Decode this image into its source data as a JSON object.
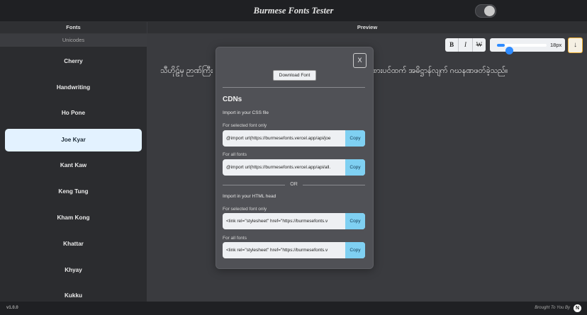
{
  "app": {
    "title": "Burmese Fonts Tester",
    "version": "v1.0.0",
    "credit": "Brought To You By",
    "credit_logo": "N"
  },
  "sidebar": {
    "header": "Fonts",
    "unicodes": "Unicodes",
    "items": [
      {
        "label": "Cherry"
      },
      {
        "label": "Handwriting"
      },
      {
        "label": "Ho Pone"
      },
      {
        "label": "Joe Kyar",
        "selected": true
      },
      {
        "label": "Kant Kaw"
      },
      {
        "label": "Keng Tung"
      },
      {
        "label": "Kham Kong"
      },
      {
        "label": "Khattar"
      },
      {
        "label": "Khyay"
      },
      {
        "label": "Kukku"
      }
    ]
  },
  "preview": {
    "header": "Preview",
    "text_left": "သီဟိုဠ်မှ ဉာဏ်ကြီး",
    "text_right": "စားပင်ထက် အဓိဋ္ဌာန်လျက် ဂဃနဏဖတ်ခဲ့သည်။",
    "bold": "B",
    "italic": "I",
    "strike": "W",
    "font_size": "18px",
    "font_size_fraction": 0.1,
    "download_icon": "↓"
  },
  "modal": {
    "close": "X",
    "download_font": "Download Font",
    "cdn_title": "CDNs",
    "css_section": "Import in your CSS file",
    "html_section": "Import in your HTML head",
    "or": "OR",
    "selected_label": "For selected font only",
    "all_label": "For all fonts",
    "copy": "Copy",
    "css_selected": "@import url(https://burmesefonts.vercel.app/api/joe",
    "css_all": "@import url(https://burmesefonts.vercel.app/api/all.",
    "html_selected": "<link rel=\"stylesheet\" href=\"https://burmesefonts.v",
    "html_all": "<link rel=\"stylesheet\" href=\"https://burmesefonts.v"
  },
  "colors": {
    "selected_bg": "#e3f2ff",
    "copy_bg": "#7fd0f2",
    "accent": "#2e8bff",
    "download_border": "#f2b232"
  }
}
